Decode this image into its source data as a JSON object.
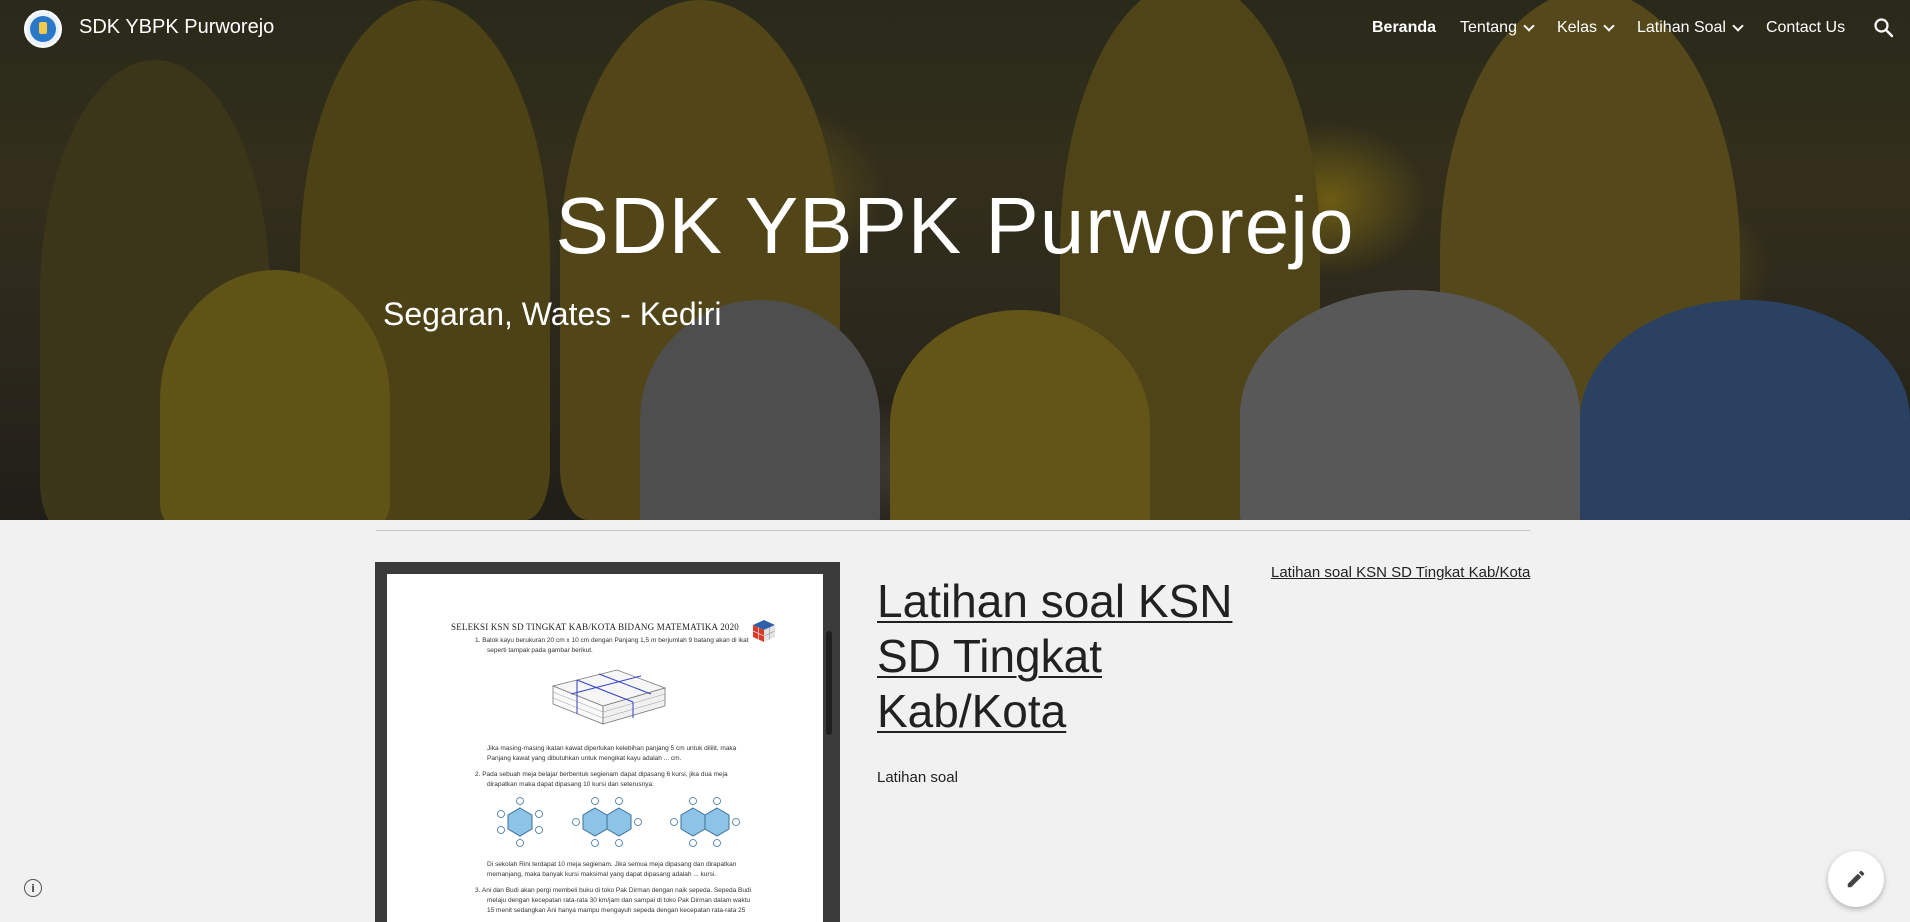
{
  "header": {
    "site_name": "SDK YBPK Purworejo",
    "nav": [
      {
        "label": "Beranda",
        "active": true,
        "has_dropdown": false
      },
      {
        "label": "Tentang",
        "active": false,
        "has_dropdown": true
      },
      {
        "label": "Kelas",
        "active": false,
        "has_dropdown": true
      },
      {
        "label": "Latihan Soal",
        "active": false,
        "has_dropdown": true
      },
      {
        "label": "Contact Us",
        "active": false,
        "has_dropdown": false
      }
    ],
    "search_icon": "search-icon"
  },
  "hero": {
    "title": "SDK YBPK Purworejo",
    "subtitle": "Segaran, Wates - Kediri"
  },
  "document": {
    "title": "SELEKSI KSN SD TINGKAT KAB/KOTA BIDANG MATEMATIKA 2020",
    "lines": [
      "1.   Balok kayu berukuran 20 cm x 10 cm dengan Panjang 1,5 m berjumlah 9 batang akan di ikat",
      "seperti tampak pada gambar berikut.",
      "Jika masing-masing ikatan kawat diperlukan kelebihan panjang 5 cm untuk dililit, maka",
      "Panjang kawat yang dibutuhkan untuk mengikat kayu adalah ... cm.",
      "2.   Pada sebuah meja belajar berbentuk segienam dapat dipasang 6 kursi, jika dua meja",
      "dirapatkan maka dapat dipasang 10 kursi dan seterusnya.",
      "Di sekolah Rini terdapat 10 meja segienam. Jika semua meja dipasang dan dirapatkan",
      "memanjang, maka banyak kursi maksimal yang dapat dipasang adalah ... kursi.",
      "3.   Ani dan Budi akan pergi membeli buku di toko Pak Dirman dengan naik sepeda. Sepeda Budi",
      "melaju dengan kecepatan rata-rata 30 km/jam dan sampai di toko Pak Dirman dalam waktu",
      "15 menit sedangkan Ani hanya mampu mengayuh sepeda dengan kecepatan rata-rata 25"
    ]
  },
  "post": {
    "title": "Latihan soal KSN SD Tingkat Kab/Kota",
    "description": "Latihan soal"
  },
  "sidebar": {
    "link": "Latihan soal KSN SD Tingkat Kab/Kota"
  },
  "footer": {
    "info_icon": "info-icon",
    "edit_icon": "pencil-icon"
  },
  "colors": {
    "text": "#212121",
    "page_bg": "#f1f1f1",
    "header_text": "#ffffff",
    "hero_yellow": "#d4b31a"
  }
}
